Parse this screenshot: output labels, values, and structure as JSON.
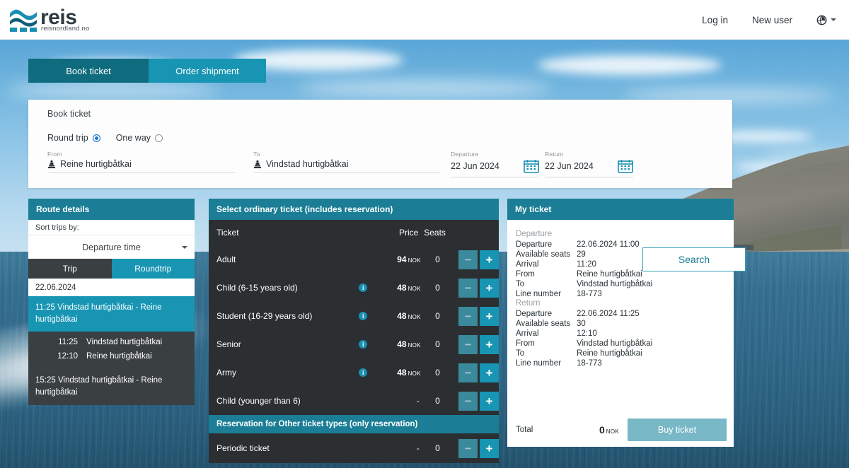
{
  "header": {
    "logo_text": "reis",
    "logo_sub": "reisnordland.no",
    "links": [
      {
        "label": "Log in",
        "name": "login-link"
      },
      {
        "label": "New user",
        "name": "new-user-link"
      }
    ],
    "language_icon": "globe-icon"
  },
  "top_tabs": [
    {
      "label": "Book ticket",
      "active": true
    },
    {
      "label": "Order shipment",
      "active": false
    }
  ],
  "search_panel": {
    "title": "Book ticket",
    "trip_type": {
      "roundtrip_label": "Round trip",
      "oneway_label": "One way",
      "selected": "Round trip"
    },
    "from": {
      "label": "From",
      "value": "Reine hurtigbåtkai",
      "icon": "port-icon"
    },
    "to": {
      "label": "To",
      "value": "Vindstad hurtigbåtkai",
      "icon": "port-icon"
    },
    "departure": {
      "label": "Departure",
      "value": "22 Jun 2024",
      "icon": "calendar-icon"
    },
    "return": {
      "label": "Return",
      "value": "22 Jun 2024",
      "icon": "calendar-icon"
    },
    "search_button": "Search"
  },
  "route_details": {
    "title": "Route details",
    "sort_label": "Sort trips by:",
    "sort_value": "Departure time",
    "tabs": [
      {
        "label": "Trip",
        "active": false
      },
      {
        "label": "Roundtrip",
        "active": true
      }
    ],
    "date": "22.06.2024",
    "trips": [
      {
        "label": "11:25 Vindstad hurtigbåtkai - Reine hurtigbåtkai",
        "selected": true,
        "legs": [
          {
            "time": "11:25",
            "place": "Vindstad hurtigbåtkai"
          },
          {
            "time": "12:10",
            "place": "Reine hurtigbåtkai"
          }
        ]
      },
      {
        "label": "15:25 Vindstad hurtigbåtkai - Reine hurtigbåtkai",
        "selected": false,
        "legs": []
      }
    ]
  },
  "tickets": {
    "title": "Select ordinary ticket (includes reservation)",
    "columns": {
      "ticket": "Ticket",
      "price": "Price",
      "seats": "Seats"
    },
    "currency": "NOK",
    "minus_label": "−",
    "plus_label": "+",
    "rows": [
      {
        "name": "Adult",
        "info": false,
        "price": "94",
        "currency": "NOK",
        "seats": "0"
      },
      {
        "name": "Child (6-15 years old)",
        "info": true,
        "price": "48",
        "currency": "NOK",
        "seats": "0"
      },
      {
        "name": "Student (16-29 years old)",
        "info": true,
        "price": "48",
        "currency": "NOK",
        "seats": "0"
      },
      {
        "name": "Senior",
        "info": true,
        "price": "48",
        "currency": "NOK",
        "seats": "0"
      },
      {
        "name": "Army",
        "info": true,
        "price": "48",
        "currency": "NOK",
        "seats": "0"
      },
      {
        "name": "Child (younger than 6)",
        "info": false,
        "price": "-",
        "currency": "",
        "seats": "0"
      }
    ],
    "other_title": "Reservation for Other ticket types (only reservation)",
    "other_rows": [
      {
        "name": "Periodic ticket",
        "info": false,
        "price": "-",
        "currency": "",
        "seats": "0"
      }
    ]
  },
  "my_ticket": {
    "title": "My ticket",
    "departure_section": {
      "heading": "Departure",
      "rows": [
        {
          "key": "Departure",
          "value": "22.06.2024 11:00"
        },
        {
          "key": "Available seats",
          "value": "29"
        },
        {
          "key": "Arrival",
          "value": "11:20"
        },
        {
          "key": "From",
          "value": "Reine hurtigbåtkai"
        },
        {
          "key": "To",
          "value": "Vindstad hurtigbåtkai"
        },
        {
          "key": "Line number",
          "value": "18-773"
        }
      ]
    },
    "return_section": {
      "heading": "Return",
      "rows": [
        {
          "key": "Departure",
          "value": "22.06.2024 11:25"
        },
        {
          "key": "Available seats",
          "value": "30"
        },
        {
          "key": "Arrival",
          "value": "12:10"
        },
        {
          "key": "From",
          "value": "Vindstad hurtigbåtkai"
        },
        {
          "key": "To",
          "value": "Reine hurtigbåtkai"
        },
        {
          "key": "Line number",
          "value": "18-773"
        }
      ]
    },
    "total_label": "Total",
    "total_value": "0",
    "total_currency": "NOK",
    "buy_button": "Buy ticket"
  },
  "colors": {
    "teal_dark": "#0f6b7e",
    "teal": "#1795b3",
    "panel_head": "#1b7e96",
    "dark": "#2b2f31",
    "dark_alt": "#3a3f41",
    "buy": "#79b8c6",
    "radio_blue": "#1b73c4"
  }
}
